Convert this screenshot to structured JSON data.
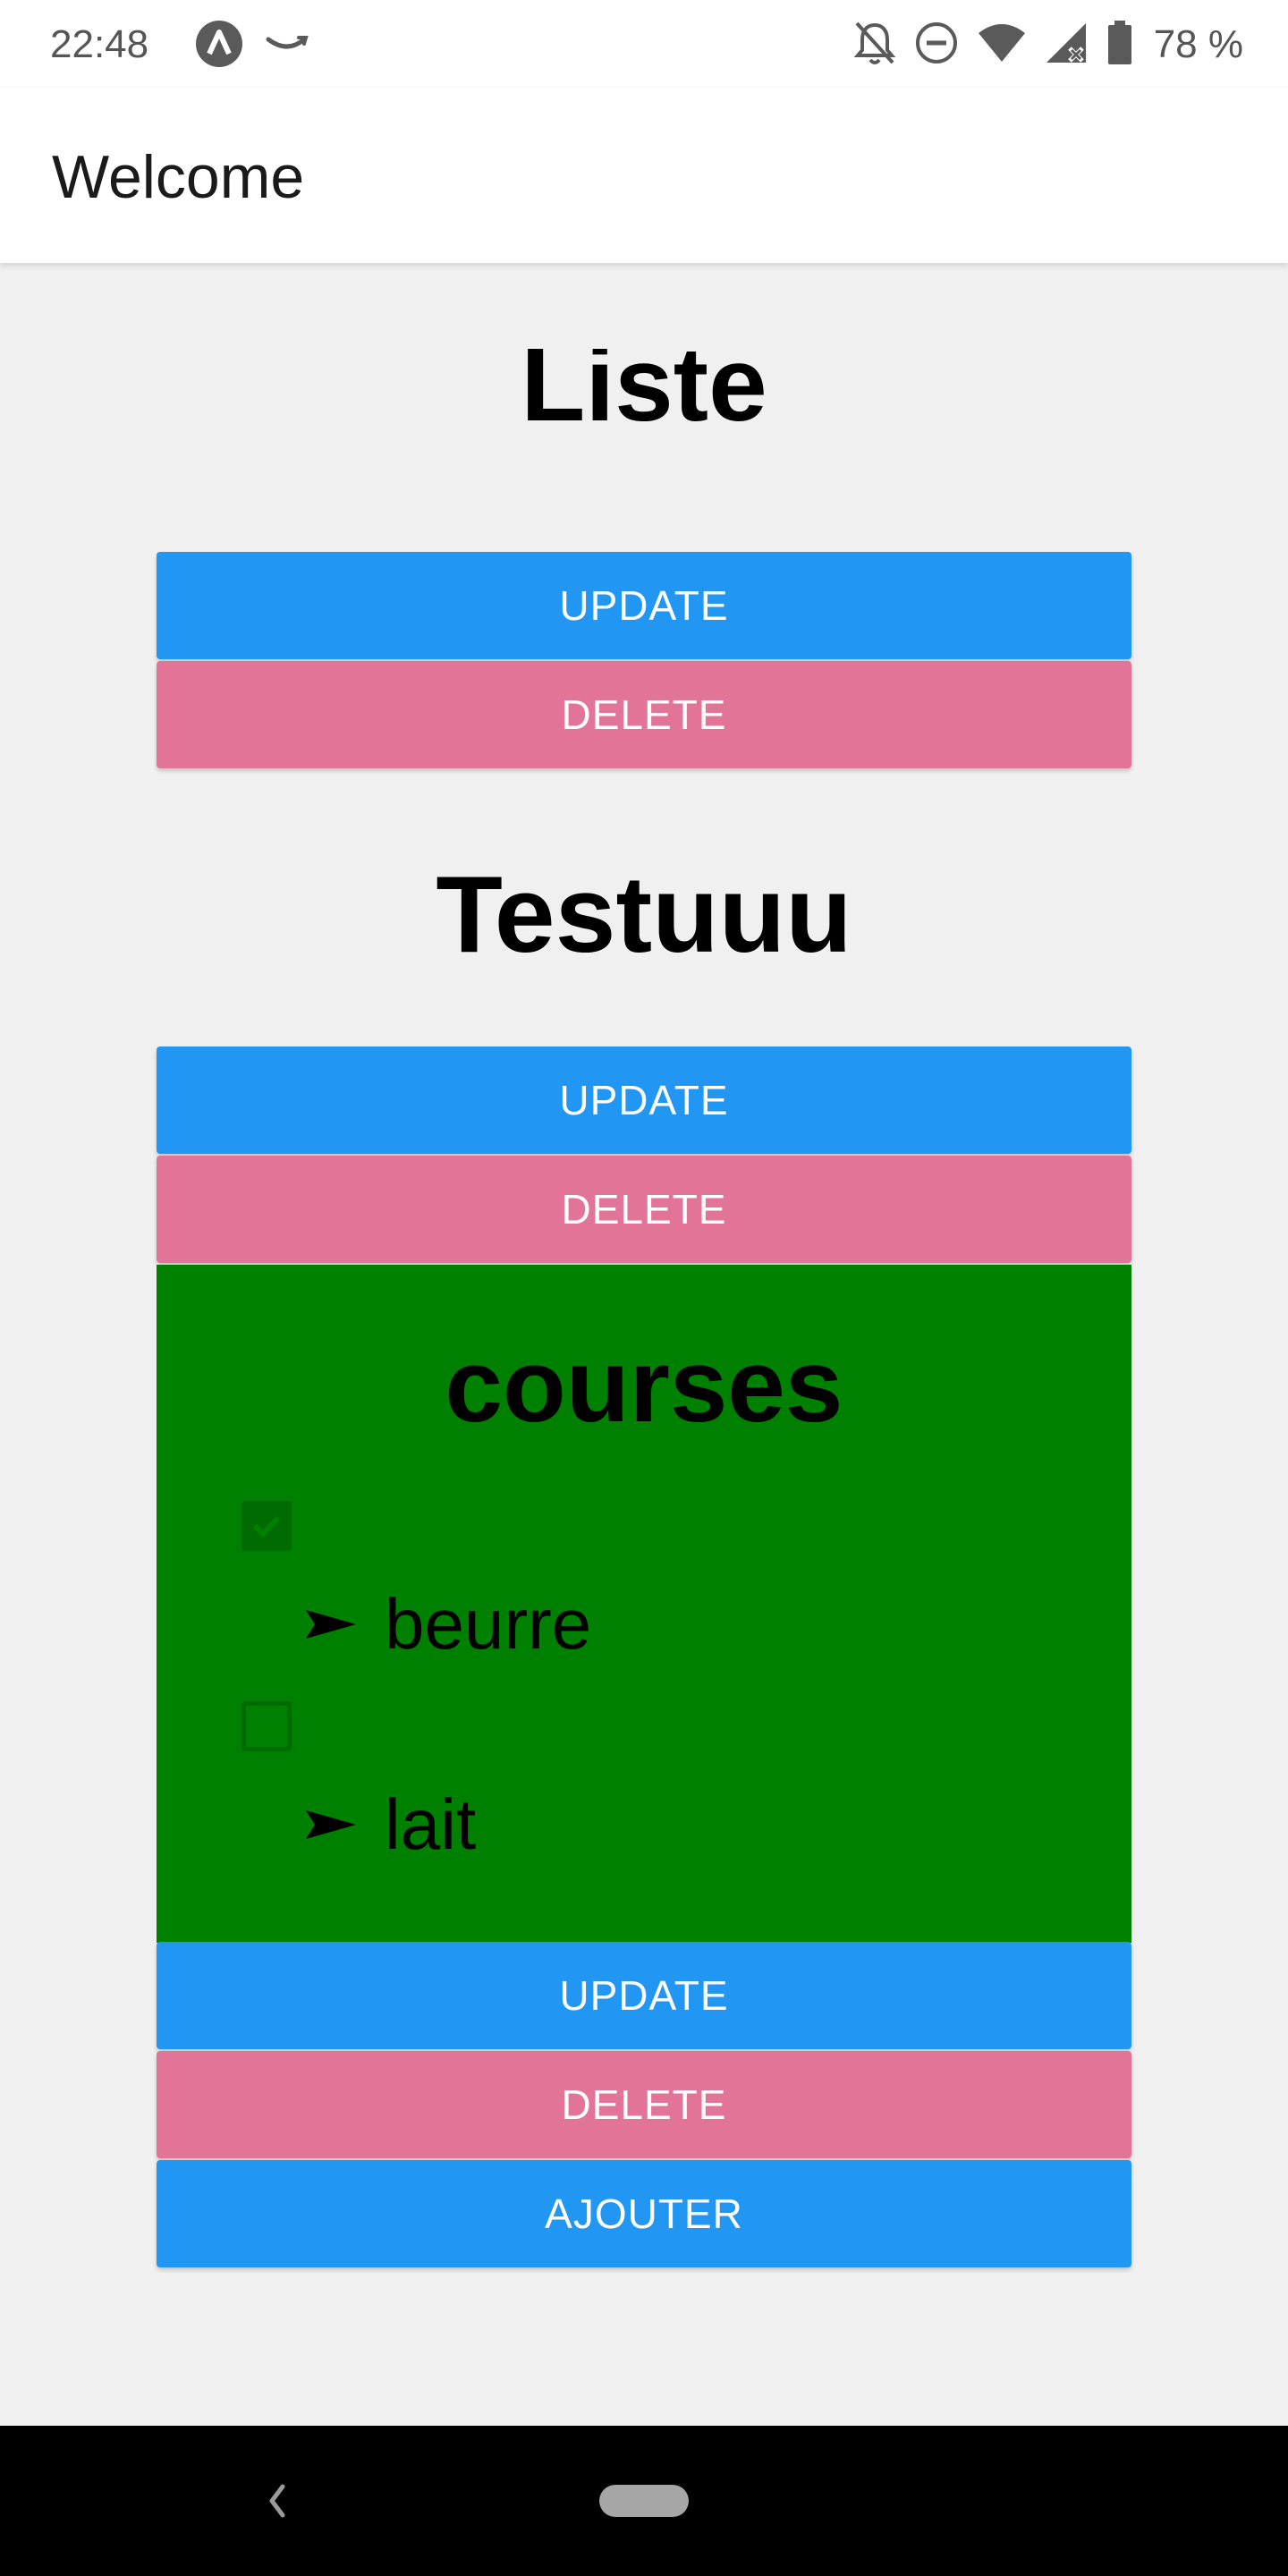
{
  "status_bar": {
    "time": "22:48",
    "battery": "78 %",
    "icons": [
      "app-a-icon",
      "amazon-smile-icon",
      "notifications-off-icon",
      "do-not-disturb-icon",
      "wifi-icon",
      "signal-no-data-icon",
      "battery-icon"
    ]
  },
  "app_bar": {
    "title": "Welcome"
  },
  "lists": [
    {
      "title": "Liste",
      "update_label": "UPDATE",
      "delete_label": "DELETE"
    },
    {
      "title": "Testuuu",
      "update_label": "UPDATE",
      "delete_label": "DELETE"
    },
    {
      "title": "courses",
      "background": "#008000",
      "items": [
        {
          "label": "beurre",
          "checked": true
        },
        {
          "label": "lait",
          "checked": false
        }
      ],
      "update_label": "UPDATE",
      "delete_label": "DELETE"
    }
  ],
  "add_button_label": "AJOUTER",
  "colors": {
    "update": "#2196f3",
    "delete": "#e27597",
    "background": "#f0f0f0"
  },
  "nav_bar": {
    "icons": [
      "back-icon",
      "home-pill-icon"
    ]
  }
}
